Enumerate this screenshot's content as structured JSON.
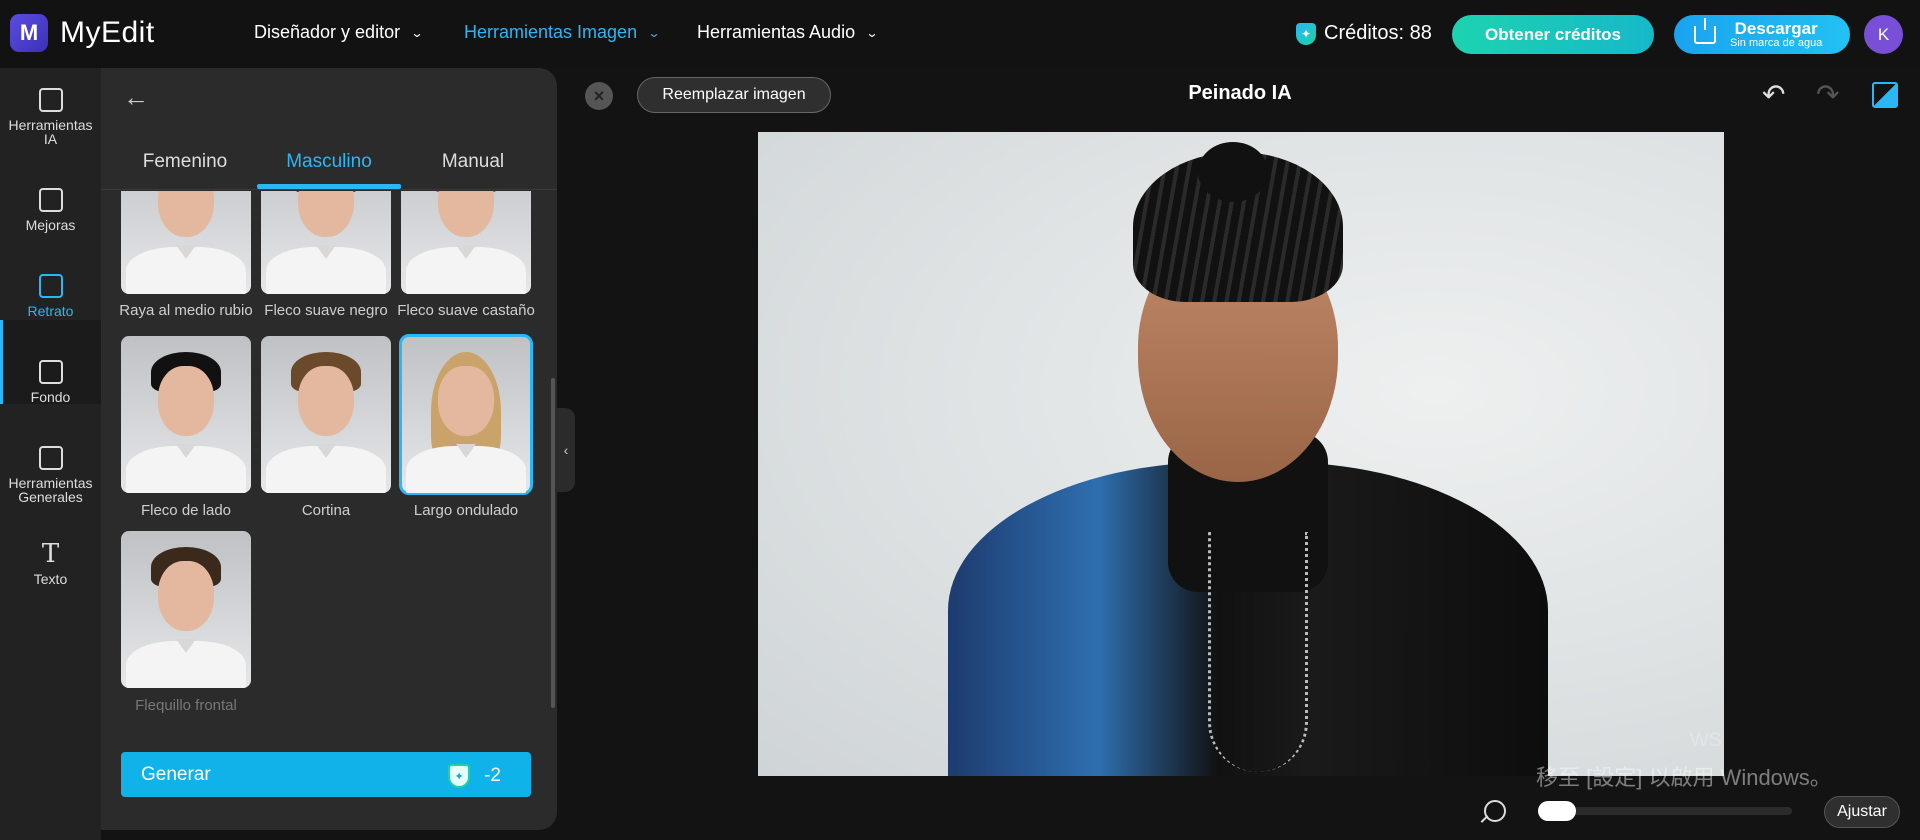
{
  "app": {
    "name": "MyEdit",
    "logo_letter": "M"
  },
  "nav": [
    {
      "label": "Diseñador y editor",
      "active": false
    },
    {
      "label": "Herramientas Imagen",
      "active": true
    },
    {
      "label": "Herramientas Audio",
      "active": false
    }
  ],
  "header": {
    "credits_label": "Créditos: 88",
    "get_credits": "Obtener créditos",
    "download_main": "Descargar",
    "download_sub": "Sin marca de agua",
    "avatar_letter": "K"
  },
  "rail": [
    {
      "label": "Herramientas IA",
      "icon": "magic-wand-icon"
    },
    {
      "label": "Mejoras",
      "icon": "image-enhance-icon"
    },
    {
      "label": "Retrato",
      "icon": "portrait-icon",
      "active": true
    },
    {
      "label": "Fondo",
      "icon": "background-icon"
    },
    {
      "label": "Herramientas Generales",
      "icon": "layers-icon"
    },
    {
      "label": "Texto",
      "icon": "text-icon"
    }
  ],
  "panel": {
    "tabs": [
      "Femenino",
      "Masculino",
      "Manual"
    ],
    "active_tab": "Masculino",
    "styles": [
      {
        "label": "Raya al medio rubio",
        "hair": "#d8c08a"
      },
      {
        "label": "Fleco suave negro",
        "hair": "#2a2420"
      },
      {
        "label": "Fleco suave castaño",
        "hair": "#6b4b32"
      },
      {
        "label": "Fleco de lado",
        "hair": "#111111"
      },
      {
        "label": "Cortina",
        "hair": "#6a4a2a"
      },
      {
        "label": "Largo ondulado",
        "hair": "#c9a36a",
        "selected": true
      },
      {
        "label": "Flequillo frontal",
        "hair": "#3b2a1c",
        "dim": true
      }
    ],
    "generate": {
      "label": "Generar",
      "cost": "-2"
    }
  },
  "canvas": {
    "replace_label": "Reemplazar imagen",
    "title": "Peinado IA",
    "fit_label": "Ajustar",
    "zoom_fraction": 0.0
  },
  "watermark": {
    "line1": "移至 [設定] 以啟用 Windows。",
    "line2": "ws"
  },
  "colors": {
    "accent": "#2ab7f5",
    "generate": "#0fb3ea",
    "credits_btn": "#1dd3b0"
  }
}
